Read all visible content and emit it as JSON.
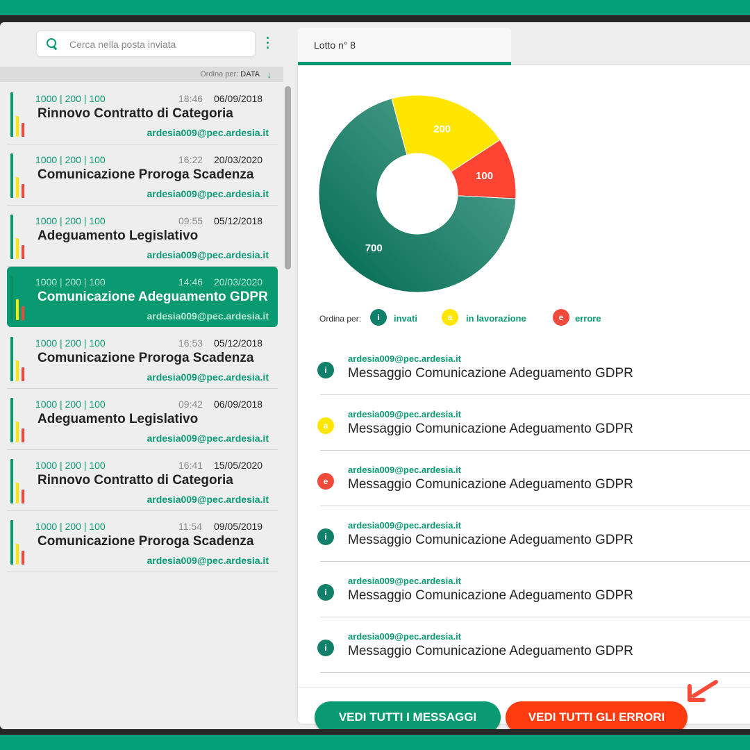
{
  "search": {
    "placeholder": "Cerca nella posta inviata"
  },
  "sort": {
    "label": "Ordina per:",
    "value": "DATA"
  },
  "messages_list": [
    {
      "counts": "1000 | 200 | 100",
      "time": "18:46",
      "date": "06/09/2018",
      "subject": "Rinnovo Contratto di Categoria",
      "email": "ardesia009@pec.ardesia.it",
      "active": false
    },
    {
      "counts": "1000 | 200 | 100",
      "time": "16:22",
      "date": "20/03/2020",
      "subject": "Comunicazione Proroga Scadenza",
      "email": "ardesia009@pec.ardesia.it",
      "active": false
    },
    {
      "counts": "1000 | 200 | 100",
      "time": "09:55",
      "date": "05/12/2018",
      "subject": "Adeguamento Legislativo",
      "email": "ardesia009@pec.ardesia.it",
      "active": false
    },
    {
      "counts": "1000 | 200 | 100",
      "time": "14:46",
      "date": "20/03/2020",
      "subject": "Comunicazione Adeguamento GDPR",
      "email": "ardesia009@pec.ardesia.it",
      "active": true
    },
    {
      "counts": "1000 | 200 | 100",
      "time": "16:53",
      "date": "05/12/2018",
      "subject": "Comunicazione Proroga Scadenza",
      "email": "ardesia009@pec.ardesia.it",
      "active": false
    },
    {
      "counts": "1000 | 200 | 100",
      "time": "09:42",
      "date": "06/09/2018",
      "subject": "Adeguamento Legislativo",
      "email": "ardesia009@pec.ardesia.it",
      "active": false
    },
    {
      "counts": "1000 | 200 | 100",
      "time": "16:41",
      "date": "15/05/2020",
      "subject": "Rinnovo Contratto di Categoria",
      "email": "ardesia009@pec.ardesia.it",
      "active": false
    },
    {
      "counts": "1000 | 200 | 100",
      "time": "11:54",
      "date": "09/05/2019",
      "subject": "Comunicazione Proroga Scadenza",
      "email": "ardesia009@pec.ardesia.it",
      "active": false
    }
  ],
  "tab": {
    "label": "Lotto n° 8"
  },
  "chart_data": {
    "type": "pie",
    "slices": [
      {
        "label": "200",
        "value": 200,
        "color": "#ffe600"
      },
      {
        "label": "100",
        "value": 100,
        "color": "#ff4433"
      },
      {
        "label": "700",
        "value": 700,
        "color": "#0d7e64"
      }
    ]
  },
  "legend": {
    "title": "Ordina per:",
    "items": [
      {
        "letter": "i",
        "label": "invati",
        "color": "#10806a"
      },
      {
        "letter": "a",
        "label": "in lavorazione",
        "color": "#ffe600"
      },
      {
        "letter": "e",
        "label": "errore",
        "color": "#f04a3a"
      }
    ]
  },
  "detail_messages": [
    {
      "status": "i",
      "color": "#10806a",
      "email": "ardesia009@pec.ardesia.it",
      "subject": "Messaggio Comunicazione Adeguamento GDPR"
    },
    {
      "status": "a",
      "color": "#ffe600",
      "email": "ardesia009@pec.ardesia.it",
      "subject": "Messaggio Comunicazione Adeguamento GDPR"
    },
    {
      "status": "e",
      "color": "#f04a3a",
      "email": "ardesia009@pec.ardesia.it",
      "subject": "Messaggio Comunicazione Adeguamento GDPR"
    },
    {
      "status": "i",
      "color": "#10806a",
      "email": "ardesia009@pec.ardesia.it",
      "subject": "Messaggio Comunicazione Adeguamento GDPR"
    },
    {
      "status": "i",
      "color": "#10806a",
      "email": "ardesia009@pec.ardesia.it",
      "subject": "Messaggio Comunicazione Adeguamento GDPR"
    },
    {
      "status": "i",
      "color": "#10806a",
      "email": "ardesia009@pec.ardesia.it",
      "subject": "Messaggio Comunicazione Adeguamento GDPR"
    }
  ],
  "buttons": {
    "all_messages": "VEDI TUTTI I MESSAGGI",
    "all_errors": "VEDI TUTTI GLI ERRORI"
  },
  "colors": {
    "brand": "#0a9a72",
    "error": "#ff3b10",
    "warning": "#ffe600"
  },
  "icons": {
    "search": "search-icon",
    "menu": "kebab-menu-icon",
    "sort": "arrow-down-icon",
    "pointer": "pointer-arrow-icon"
  }
}
